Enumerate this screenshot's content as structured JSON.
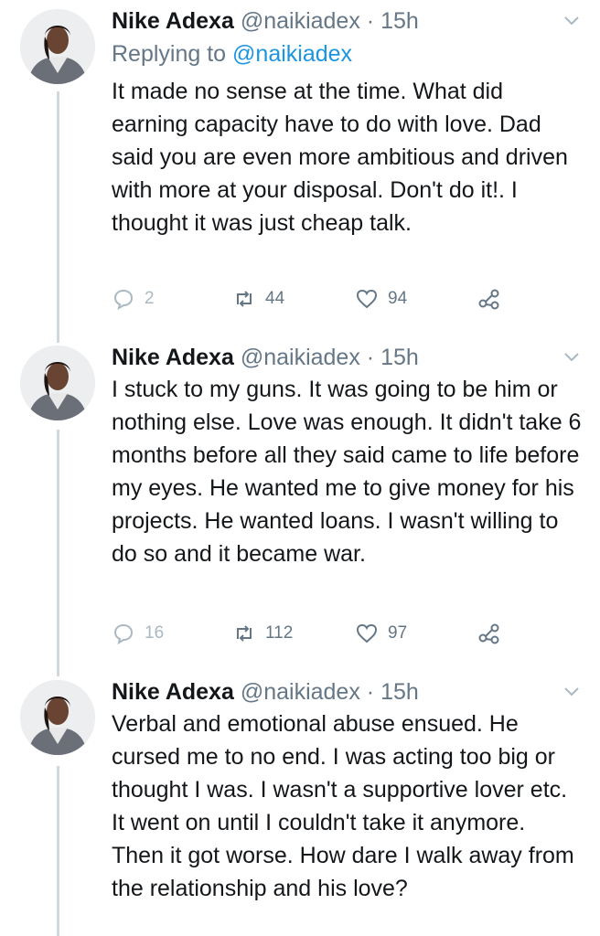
{
  "tweets": [
    {
      "name": "Nike Adexa",
      "handle": "@naikiadex",
      "sep": "·",
      "time": "15h",
      "replying_prefix": "Replying to",
      "replying_handle": "@naikiadex",
      "text": "It made no sense at the time. What did earning capacity have to do with love. Dad said you are even more ambitious and driven with more at your disposal. Don't do it!. I thought it was just cheap talk.",
      "replies": "2",
      "retweets": "44",
      "likes": "94"
    },
    {
      "name": "Nike Adexa",
      "handle": "@naikiadex",
      "sep": "·",
      "time": "15h",
      "text": "I stuck to my guns. It was going to be him or nothing else. Love was enough. It didn't take 6 months before all they said came to life before my eyes. He wanted me to give money for his projects. He wanted loans. I wasn't willing to do so and it became war.",
      "replies": "16",
      "retweets": "112",
      "likes": "97"
    },
    {
      "name": "Nike Adexa",
      "handle": "@naikiadex",
      "sep": "·",
      "time": "15h",
      "text": "Verbal and emotional abuse ensued. He cursed me to no end. I was acting too big or thought I was. I wasn't a supportive lover etc. It went on until I couldn't take it anymore. Then it got worse. How dare I walk away from the relationship and his love?"
    }
  ],
  "colors": {
    "text": "#14171a",
    "muted": "#657786",
    "link": "#1b95e0",
    "thread": "#cfd9de"
  }
}
